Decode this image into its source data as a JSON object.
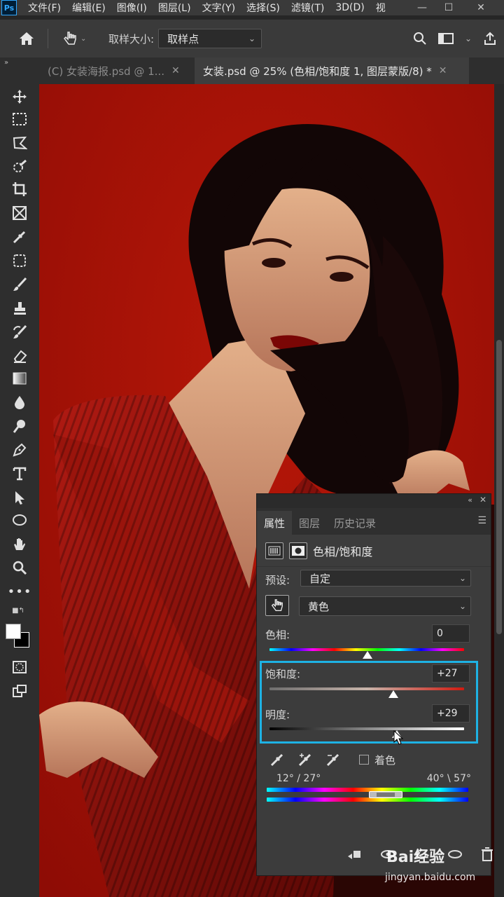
{
  "app": {
    "logo_text": "Ps"
  },
  "menu": [
    "文件(F)",
    "编辑(E)",
    "图像(I)",
    "图层(L)",
    "文字(Y)",
    "选择(S)",
    "滤镜(T)",
    "3D(D)",
    "视"
  ],
  "options_bar": {
    "sample_size_label": "取样大小:",
    "sample_size_value": "取样点"
  },
  "tabs": [
    {
      "label": "(C) 女装海报.psd @ 1...",
      "active": false
    },
    {
      "label": "女装.psd @ 25% (色相/饱和度 1, 图层蒙版/8) *",
      "active": true
    }
  ],
  "panel": {
    "tabs": [
      "属性",
      "图层",
      "历史记录"
    ],
    "title": "色相/饱和度",
    "preset_label": "预设:",
    "preset_value": "自定",
    "channel_value": "黄色",
    "hue_label": "色相:",
    "hue_value": "0",
    "saturation_label": "饱和度:",
    "saturation_value": "+27",
    "lightness_label": "明度:",
    "lightness_value": "+29",
    "colorize_label": "着色",
    "range_left": "12° / 27°",
    "range_right": "40° \\ 57°"
  },
  "watermark": {
    "brand": "Bai经验",
    "url": "jingyan.baidu.com"
  },
  "colors": {
    "canvas_bg": "#a81208",
    "highlight": "#1eb2e4",
    "panel_bg": "#3c3c3c"
  }
}
